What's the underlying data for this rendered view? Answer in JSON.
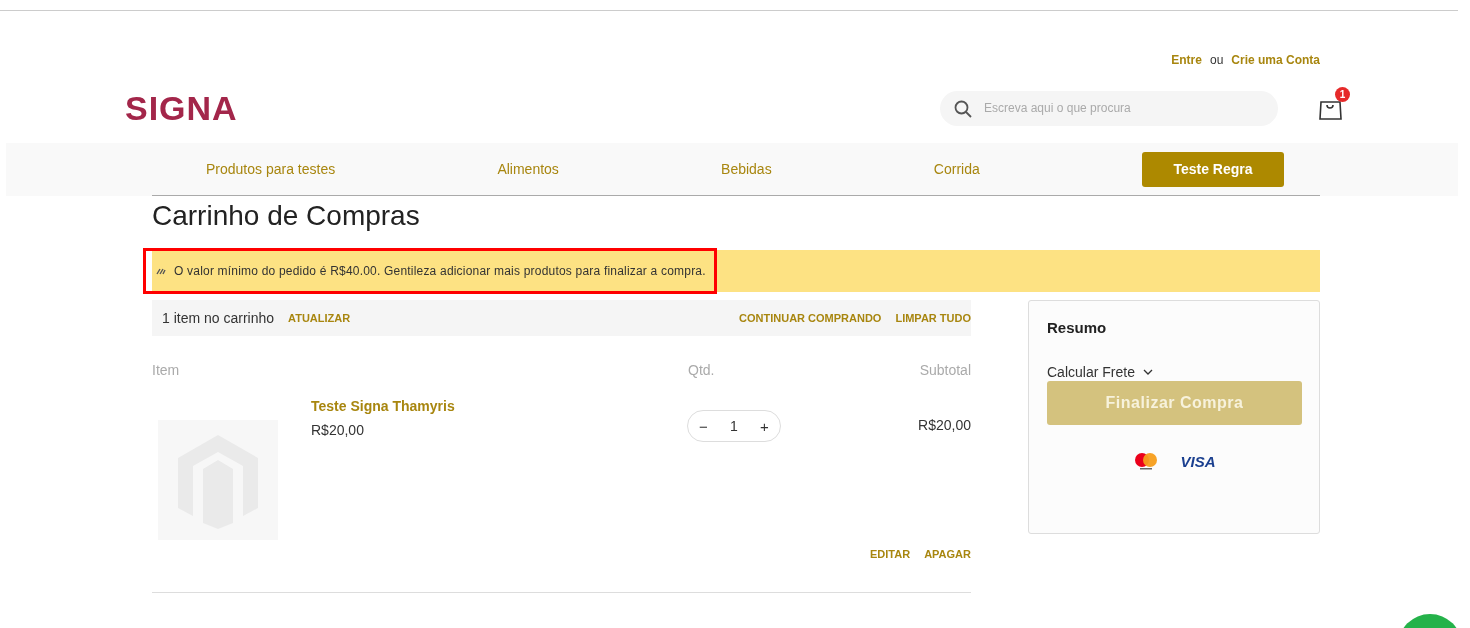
{
  "header": {
    "login_link": "Entre",
    "separator": "ou",
    "signup_link": "Crie uma Conta",
    "logo": "SIGNA",
    "search": {
      "placeholder": "Escreva aqui o que procura"
    },
    "cart_count": "1"
  },
  "nav": [
    {
      "label": "Produtos para testes",
      "kind": "link"
    },
    {
      "label": "Alimentos",
      "kind": "link"
    },
    {
      "label": "Bebidas",
      "kind": "link"
    },
    {
      "label": "Corrida",
      "kind": "link"
    },
    {
      "label": "Teste Regra",
      "kind": "button"
    }
  ],
  "page_title": "Carrinho de Compras",
  "notice": {
    "text": "O valor mínimo do pedido é R$40.00. Gentileza adicionar mais produtos para finalizar a compra.",
    "highlighted": true
  },
  "cart_toolbar": {
    "count": "1 item no carrinho",
    "update": "ATUALIZAR",
    "continue": "CONTINUAR COMPRANDO",
    "clear": "LIMPAR TUDO"
  },
  "columns": [
    "Item",
    "Qtd.",
    "Subtotal"
  ],
  "items": [
    {
      "name": "Teste Signa Thamyris",
      "price": "R$20,00",
      "qty_decrease": "−",
      "qty": "1",
      "qty_increase": "+",
      "subtotal": "R$20,00",
      "edit": "EDITAR",
      "delete": "APAGAR"
    }
  ],
  "summary": {
    "title": "Resumo",
    "shipping": "Calcular Frete",
    "checkout": {
      "label": "Finalizar Compra",
      "disabled": true
    },
    "payment_label": "VISA"
  }
}
